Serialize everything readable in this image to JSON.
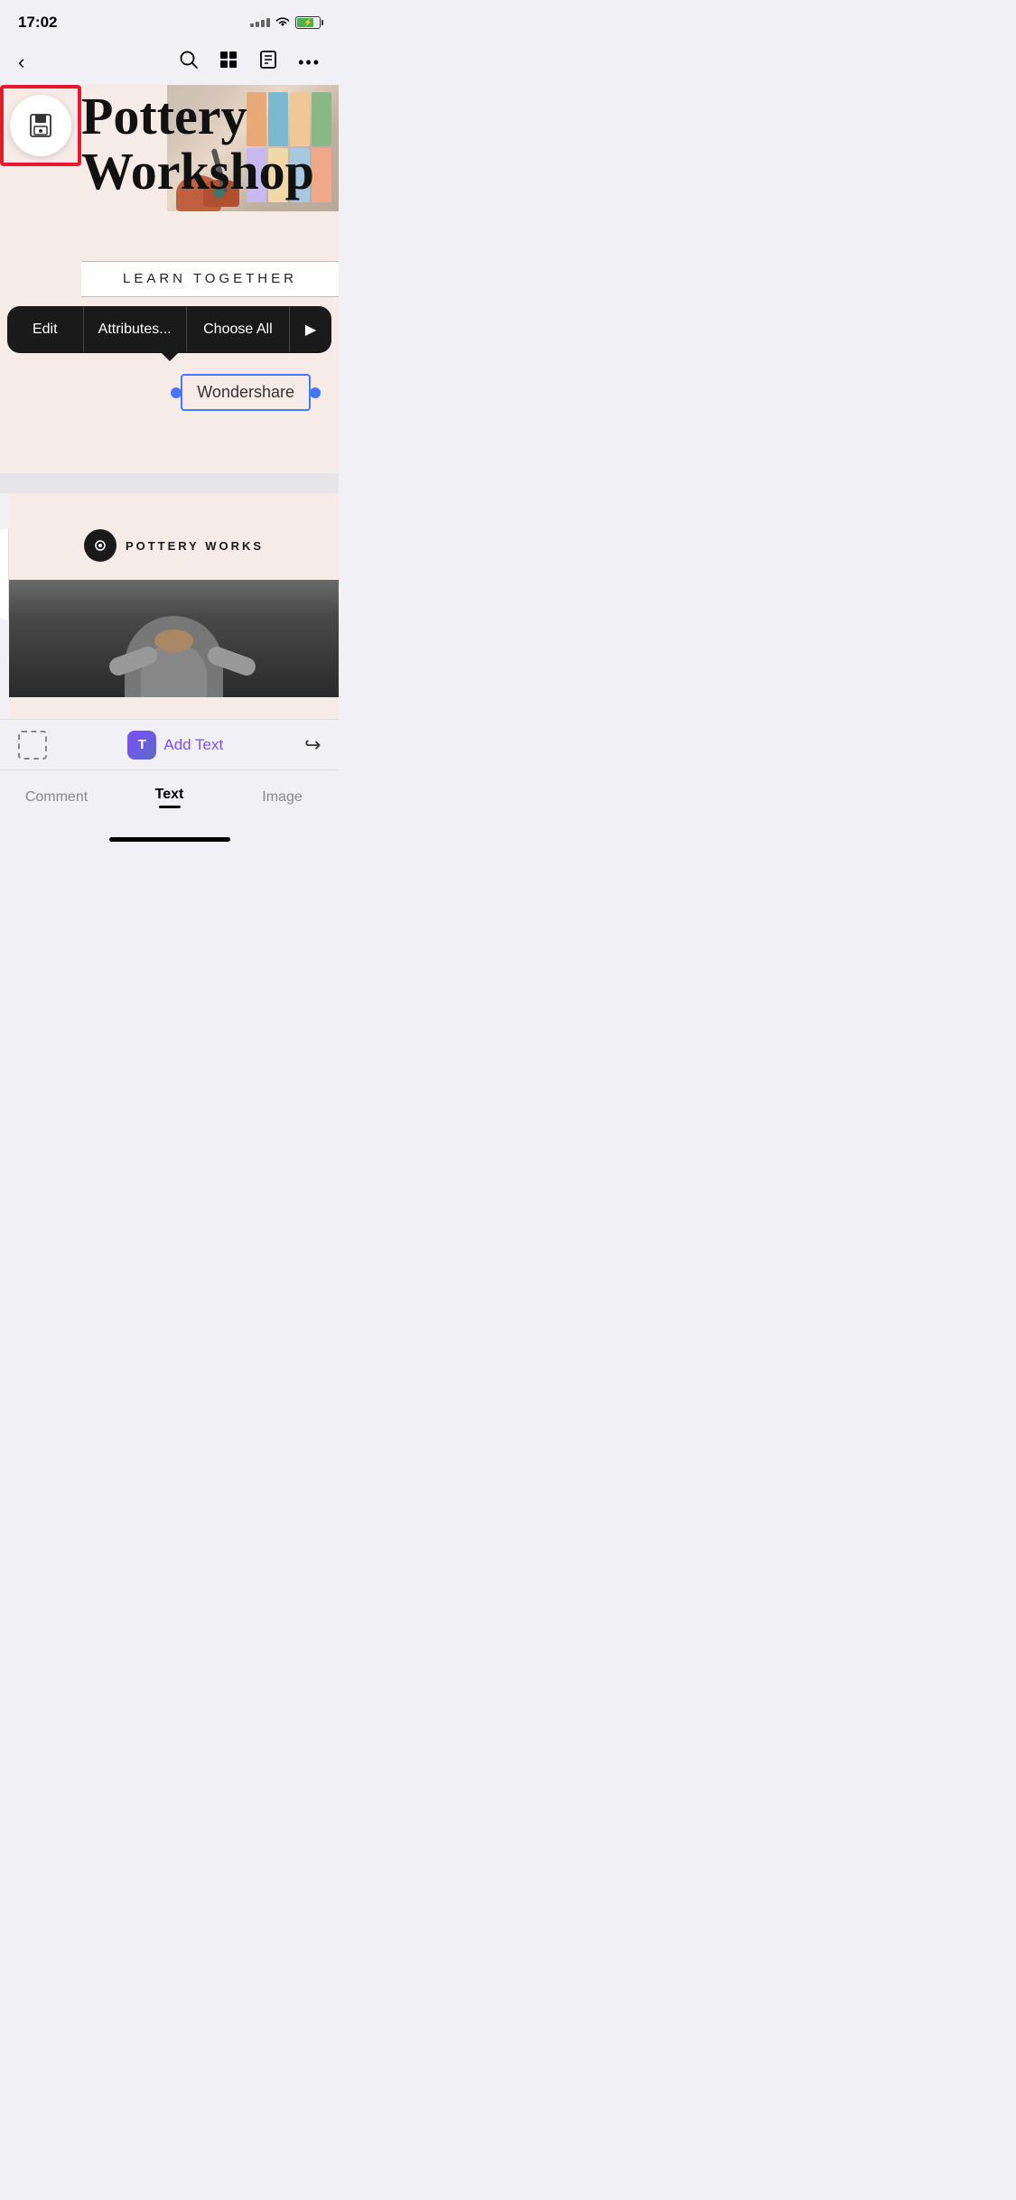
{
  "status": {
    "time": "17:02"
  },
  "toolbar": {
    "back_label": "‹",
    "more_label": "•••"
  },
  "canvas": {
    "title_line1": "Pottery",
    "title_line2": "Workshop",
    "subtitle": "LEARN TOGETHER",
    "selected_text": "Wondershare",
    "context_menu": {
      "edit": "Edit",
      "attributes": "Attributes...",
      "choose_all": "Choose All"
    },
    "page2": {
      "brand_name": "POTTERY WORKS"
    }
  },
  "bottom_toolbar": {
    "add_text_label": "Add Text",
    "add_text_icon": "T"
  },
  "tabs": {
    "comment": "Comment",
    "text": "Text",
    "image": "Image"
  },
  "colors": {
    "accent_purple": "#7c4dff",
    "selection_blue": "#4477ff",
    "highlight_red": "#e8192c",
    "bg_cream": "#f7ebe8"
  }
}
